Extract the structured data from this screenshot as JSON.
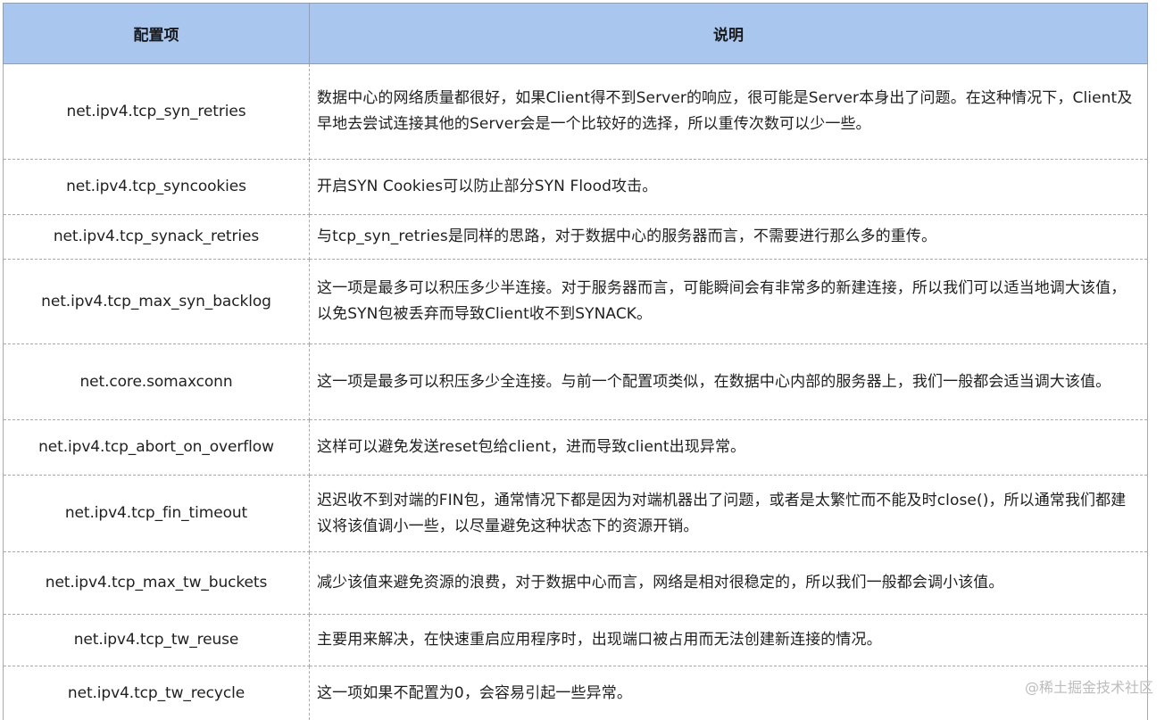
{
  "header": {
    "col_key": "配置项",
    "col_desc": "说明"
  },
  "rows": [
    {
      "key": "net.ipv4.tcp_syn_retries",
      "desc": "数据中心的网络质量都很好，如果Client得不到Server的响应，很可能是Server本身出了问题。在这种情况下，Client及早地去尝试连接其他的Server会是一个比较好的选择，所以重传次数可以少一些。"
    },
    {
      "key": "net.ipv4.tcp_syncookies",
      "desc": "开启SYN Cookies可以防止部分SYN Flood攻击。"
    },
    {
      "key": "net.ipv4.tcp_synack_retries",
      "desc": "与tcp_syn_retries是同样的思路，对于数据中心的服务器而言，不需要进行那么多的重传。"
    },
    {
      "key": "net.ipv4.tcp_max_syn_backlog",
      "desc": "这一项是最多可以积压多少半连接。对于服务器而言，可能瞬间会有非常多的新建连接，所以我们可以适当地调大该值，以免SYN包被丢弃而导致Client收不到SYNACK。"
    },
    {
      "key": "net.core.somaxconn",
      "desc": "这一项是最多可以积压多少全连接。与前一个配置项类似，在数据中心内部的服务器上，我们一般都会适当调大该值。"
    },
    {
      "key": "net.ipv4.tcp_abort_on_overflow",
      "desc": "这样可以避免发送reset包给client，进而导致client出现异常。"
    },
    {
      "key": "net.ipv4.tcp_fin_timeout",
      "desc": "迟迟收不到对端的FIN包，通常情况下都是因为对端机器出了问题，或者是太繁忙而不能及时close()，所以通常我们都建议将该值调小一些，以尽量避免这种状态下的资源开销。"
    },
    {
      "key": "net.ipv4.tcp_max_tw_buckets",
      "desc": "减少该值来避免资源的浪费，对于数据中心而言，网络是相对很稳定的，所以我们一般都会调小该值。"
    },
    {
      "key": "net.ipv4.tcp_tw_reuse",
      "desc": "主要用来解决，在快速重启应用程序时，出现端口被占用而无法创建新连接的情况。"
    },
    {
      "key": "net.ipv4.tcp_tw_recycle",
      "desc": "这一项如果不配置为0，会容易引起一些异常。"
    }
  ],
  "watermark": "@稀土掘金技术社区"
}
